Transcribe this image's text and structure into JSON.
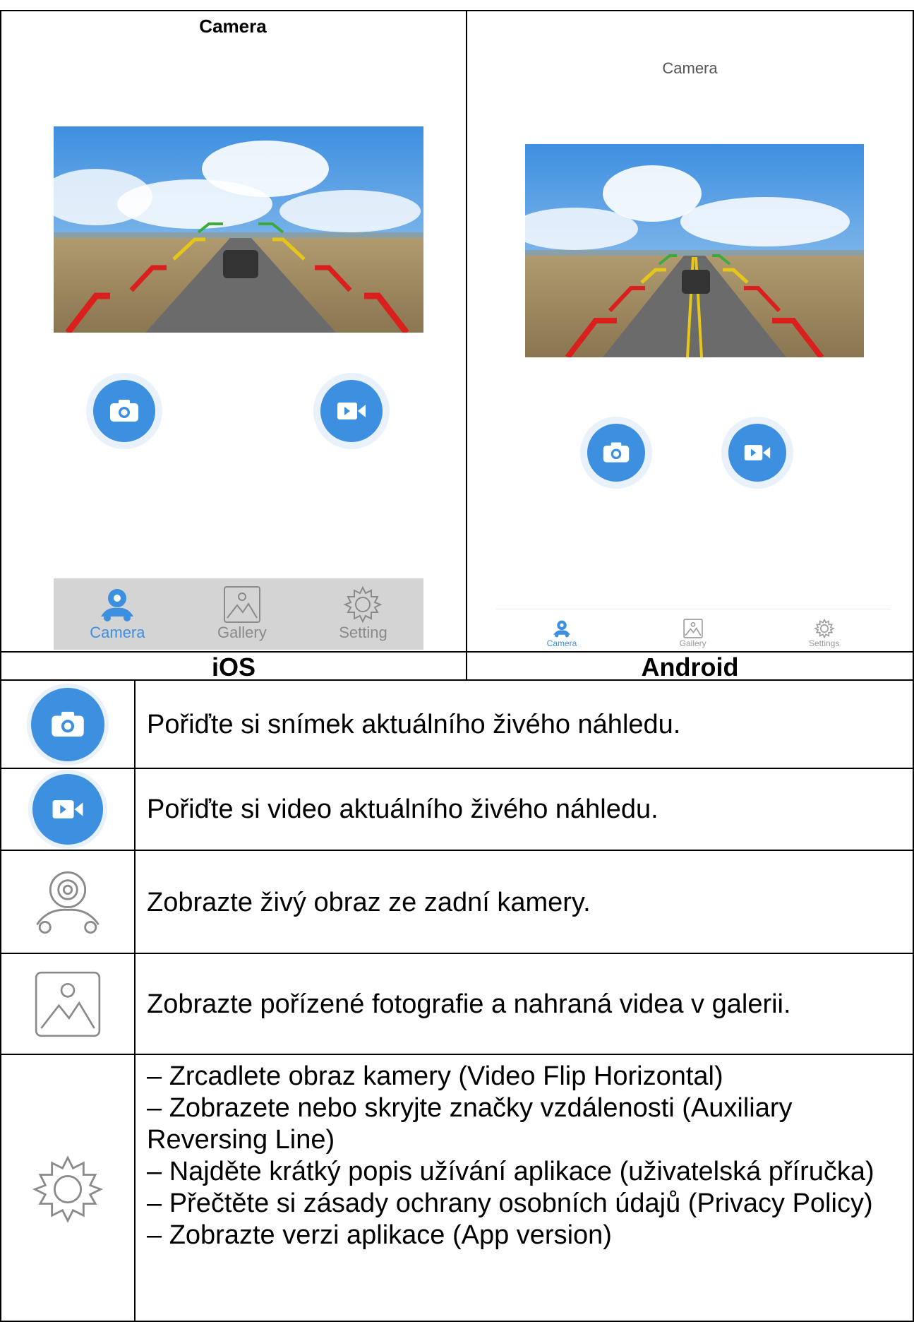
{
  "ios": {
    "title": "Camera",
    "tabs": [
      {
        "label": "Camera",
        "icon": "camera-car-icon",
        "active": true
      },
      {
        "label": "Gallery",
        "icon": "gallery-icon",
        "active": false
      },
      {
        "label": "Setting",
        "icon": "gear-icon",
        "active": false
      }
    ],
    "caption": "iOS"
  },
  "android": {
    "title": "Camera",
    "tabs": [
      {
        "label": "Camera",
        "icon": "camera-car-icon",
        "active": true
      },
      {
        "label": "Gallery",
        "icon": "gallery-icon",
        "active": false
      },
      {
        "label": "Settings",
        "icon": "gear-icon",
        "active": false
      }
    ],
    "caption": "Android"
  },
  "colors": {
    "accent": "#3d8fe0",
    "tab_inactive": "#8a8a8a",
    "guide_red": "#d9201c",
    "guide_yellow": "#e6c619",
    "guide_green": "#3cab3c"
  },
  "legend": [
    {
      "icon": "photo-button-icon",
      "text": "Pořiďte si snímek aktuálního živého náhledu."
    },
    {
      "icon": "video-button-icon",
      "text": "Pořiďte si video aktuálního živého náhledu."
    },
    {
      "icon": "camera-car-icon",
      "text": "Zobrazte živý obraz ze zadní kamery."
    },
    {
      "icon": "gallery-icon",
      "text": "Zobrazte pořízené fotografie a nahraná videa v galerii."
    },
    {
      "icon": "gear-icon",
      "lines": [
        "– Zrcadlete obraz kamery (Video Flip Horizontal)",
        "– Zobrazete nebo skryjte značky vzdálenosti (Auxiliary Reversing Line)",
        "– Najděte krátký popis užívání aplikace (uživatelská příručka)",
        "– Přečtěte si zásady ochrany osobních údajů (Privacy Policy)",
        "– Zobrazte verzi aplikace (App version)"
      ]
    }
  ]
}
